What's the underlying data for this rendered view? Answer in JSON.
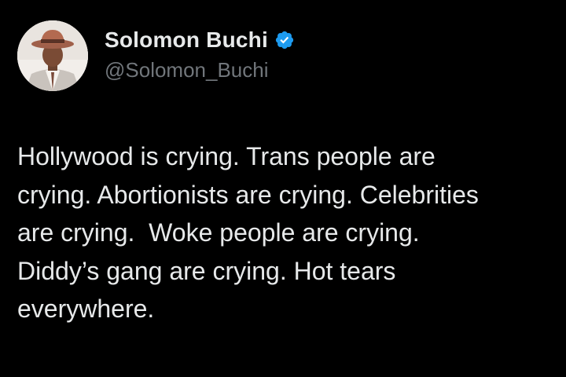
{
  "author": {
    "display_name": "Solomon Buchi",
    "handle": "@Solomon_Buchi",
    "verified": true,
    "verified_color": "#1d9bf0",
    "avatar_icon": "profile-photo"
  },
  "tweet": {
    "text": "Hollywood is crying. Trans people are\ncrying. Abortionists are crying. Celebrities\nare crying.  Woke people are crying.\nDiddy’s gang are crying. Hot tears\neverywhere."
  },
  "colors": {
    "background": "#000000",
    "text_primary": "#e7e9ea",
    "text_secondary": "#71767b"
  }
}
